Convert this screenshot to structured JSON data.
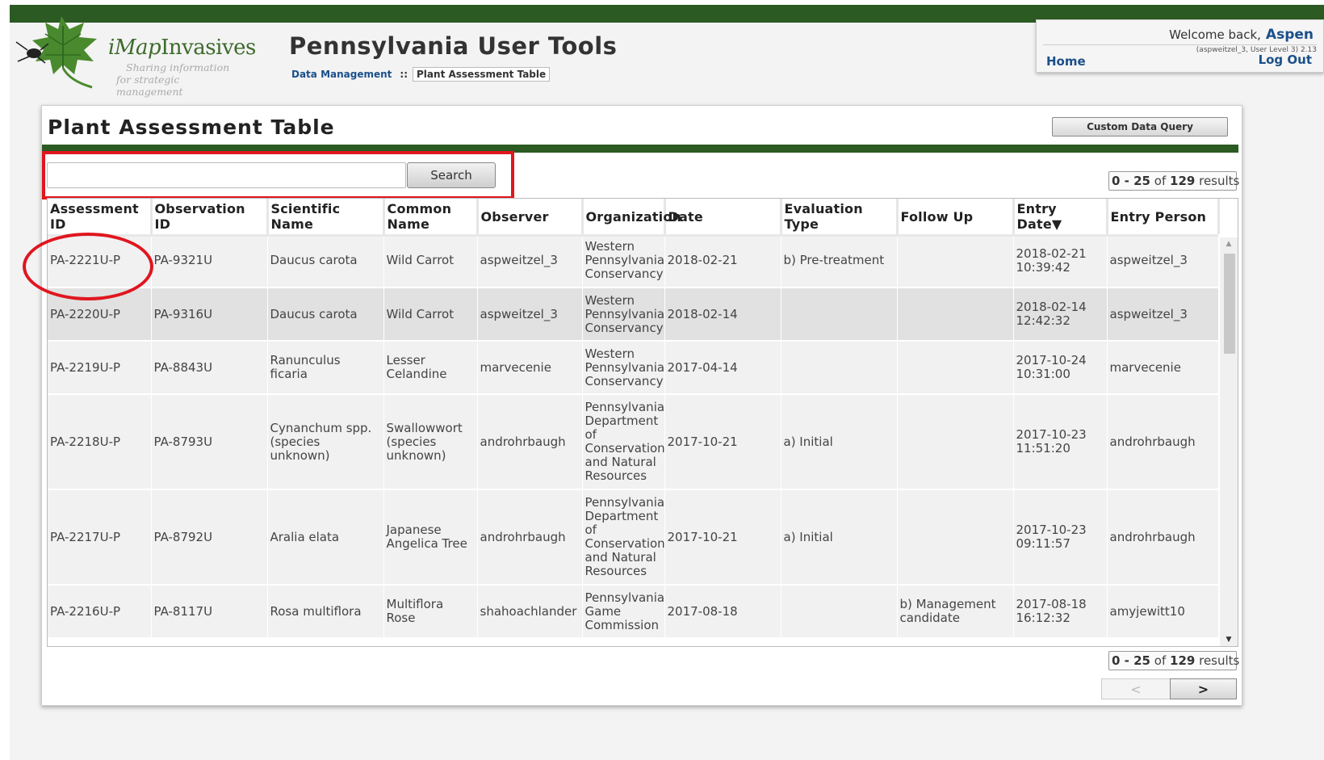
{
  "colors": {
    "brand_green": "#2b5a22",
    "link_blue": "#1a4f8a",
    "highlight_red": "#e0161f"
  },
  "logo": {
    "name_prefix": "iMap",
    "name_suffix": "Invasives",
    "tagline_1": "Sharing information",
    "tagline_2": "for strategic management",
    "icon": "leaf-logo-icon"
  },
  "header": {
    "title": "Pennsylvania User Tools",
    "breadcrumb": {
      "link": "Data Management",
      "separator": "::",
      "current": "Plant Assessment Table"
    }
  },
  "user": {
    "welcome": "Welcome back,",
    "name": "Aspen",
    "details": "(aspweitzel_3, User Level 3) 2.13",
    "home": "Home",
    "logout": "Log Out"
  },
  "main": {
    "title": "Plant Assessment Table",
    "custom_query": "Custom Data Query",
    "search": {
      "value": "",
      "placeholder": "",
      "button": "Search"
    },
    "results_top": {
      "range": "0 - 25",
      "of": "of",
      "total": "129",
      "suffix": "results"
    },
    "results_bottom": {
      "range": "0 - 25",
      "of": "of",
      "total": "129",
      "suffix": "results"
    },
    "pager": {
      "prev": "<",
      "next": ">"
    }
  },
  "table": {
    "columns": [
      "Assessment ID",
      "Observation ID",
      "Scientific Name",
      "Common Name",
      "Observer",
      "Organization",
      "Date",
      "Evaluation Type",
      "Follow Up",
      "Entry Date▼",
      "Entry Person"
    ],
    "rows": [
      [
        "PA-2221U-P",
        "PA-9321U",
        "Daucus carota",
        "Wild Carrot",
        "aspweitzel_3",
        "Western Pennsylvania Conservancy",
        "2018-02-21",
        "b) Pre-treatment",
        "",
        "2018-02-21 10:39:42",
        "aspweitzel_3"
      ],
      [
        "PA-2220U-P",
        "PA-9316U",
        "Daucus carota",
        "Wild Carrot",
        "aspweitzel_3",
        "Western Pennsylvania Conservancy",
        "2018-02-14",
        "",
        "",
        "2018-02-14 12:42:32",
        "aspweitzel_3"
      ],
      [
        "PA-2219U-P",
        "PA-8843U",
        "Ranunculus ficaria",
        "Lesser Celandine",
        "marvecenie",
        "Western Pennsylvania Conservancy",
        "2017-04-14",
        "",
        "",
        "2017-10-24 10:31:00",
        "marvecenie"
      ],
      [
        "PA-2218U-P",
        "PA-8793U",
        "Cynanchum spp. (species unknown)",
        "Swallowwort (species unknown)",
        "androhrbaugh",
        "Pennsylvania Department of Conservation and Natural Resources",
        "2017-10-21",
        "a) Initial",
        "",
        "2017-10-23 11:51:20",
        "androhrbaugh"
      ],
      [
        "PA-2217U-P",
        "PA-8792U",
        "Aralia elata",
        "Japanese Angelica Tree",
        "androhrbaugh",
        "Pennsylvania Department of Conservation and Natural Resources",
        "2017-10-21",
        "a) Initial",
        "",
        "2017-10-23 09:11:57",
        "androhrbaugh"
      ],
      [
        "PA-2216U-P",
        "PA-8117U",
        "Rosa multiflora",
        "Multiflora Rose",
        "shahoachlander",
        "Pennsylvania Game Commission",
        "2017-08-18",
        "",
        "b) Management candidate",
        "2017-08-18 16:12:32",
        "amyjewitt10"
      ]
    ]
  }
}
